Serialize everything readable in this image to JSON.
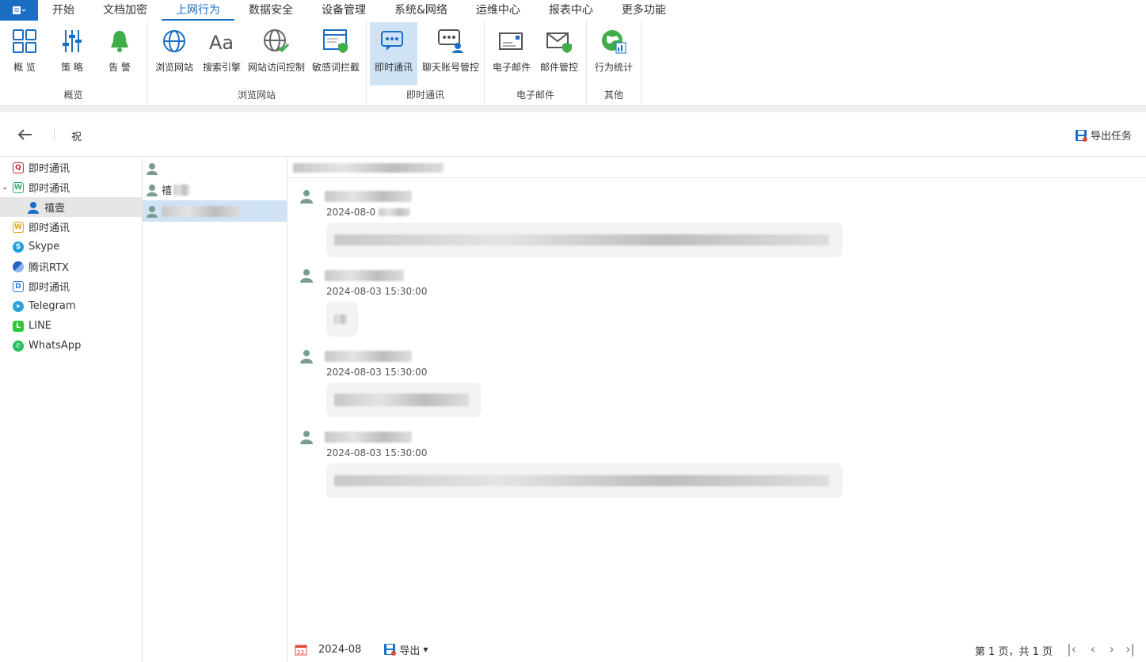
{
  "menubar": {
    "app_icon": "app-menu-icon",
    "items": [
      "开始",
      "文档加密",
      "上网行为",
      "数据安全",
      "设备管理",
      "系统&网络",
      "运维中心",
      "报表中心",
      "更多功能"
    ],
    "active": "上网行为"
  },
  "ribbon": {
    "groups": {
      "overview": "概览",
      "browse": "浏览网站",
      "im": "即时通讯",
      "email": "电子邮件",
      "other": "其他"
    },
    "buttons": {
      "overview": "概 览",
      "strategy": "策 略",
      "alert": "告 警",
      "browse_site": "浏览网站",
      "search_engine": "搜索引擎",
      "site_access": "网站访问控制",
      "sensitive": "敏感词拦截",
      "im": "即时通讯",
      "chat_account": "聊天账号管控",
      "email": "电子邮件",
      "email_control": "邮件管控",
      "behavior_stats": "行为统计"
    },
    "accent": "#1a6fc4"
  },
  "toolbar": {
    "breadcrumb": "祝",
    "export_task": "导出任务"
  },
  "tree": {
    "items": [
      {
        "label": "即时通讯",
        "icon": "qq-icon",
        "color": "#b0302f",
        "glyph": "Q"
      },
      {
        "label": "即时通讯",
        "icon": "wechat-icon",
        "color": "#2aae67",
        "glyph": "W",
        "expanded": true
      },
      {
        "label": "禧壹",
        "icon": "user-icon",
        "sub": true
      },
      {
        "label": "即时通讯",
        "icon": "wangwang-icon",
        "color": "#e8a317",
        "glyph": "W"
      },
      {
        "label": "Skype",
        "icon": "skype-icon",
        "color": "#1ca1e0",
        "glyph": "S"
      },
      {
        "label": "腾讯RTX",
        "icon": "rtx-icon",
        "color": "#2b63c4",
        "glyph": ""
      },
      {
        "label": "即时通讯",
        "icon": "dingtalk-icon",
        "color": "#2b7fe0",
        "glyph": "D"
      },
      {
        "label": "Telegram",
        "icon": "telegram-icon",
        "color": "#2aa1da",
        "glyph": "➤"
      },
      {
        "label": "LINE",
        "icon": "line-icon",
        "color": "#2dc937",
        "glyph": "L"
      },
      {
        "label": "WhatsApp",
        "icon": "whatsapp-icon",
        "color": "#25c15c",
        "glyph": "✆"
      }
    ]
  },
  "contacts": {
    "second_prefix": "禧"
  },
  "chat": {
    "messages": [
      {
        "time": "2024-08-0"
      },
      {
        "time": "2024-08-03 15:30:00"
      },
      {
        "time": "2024-08-03 15:30:00"
      },
      {
        "time": "2024-08-03 15:30:00"
      }
    ]
  },
  "footer": {
    "date": "2024-08",
    "export": "导出",
    "page_info": "第 1 页，共 1 页"
  }
}
